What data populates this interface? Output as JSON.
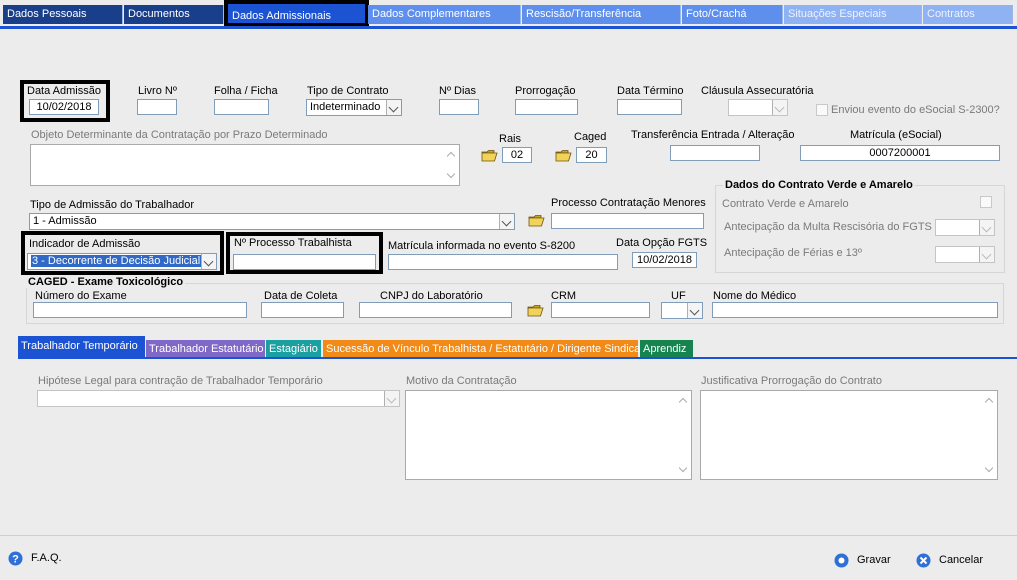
{
  "tabs": {
    "dados_pessoais": "Dados Pessoais",
    "documentos": "Documentos",
    "dados_admissionais": "Dados Admissionais",
    "dados_complementares": "Dados Complementares",
    "rescisao": "Rescisão/Transferência",
    "foto": "Foto/Crachá",
    "situacoes": "Situações Especiais",
    "contratos": "Contratos"
  },
  "form": {
    "data_admissao_label": "Data Admissão",
    "data_admissao_value": "10/02/2018",
    "livro_label": "Livro Nº",
    "folha_label": "Folha / Ficha",
    "tipo_contrato_label": "Tipo de Contrato",
    "tipo_contrato_value": "Indeterminado",
    "dias_label": "Nº Dias",
    "prorrogacao_label": "Prorrogação",
    "data_termino_label": "Data Término",
    "clausula_label": "Cláusula Assecuratória",
    "esocial_label": "Enviou evento do eSocial S-2300?",
    "objeto_label": "Objeto Determinante da Contratação por Prazo Determinado",
    "rais_label": "Rais",
    "rais_value": "02",
    "caged_label": "Caged",
    "caged_value": "20",
    "transferencia_label": "Transferência Entrada / Alteração",
    "matricula_label": "Matrícula (eSocial)",
    "matricula_value": "0007200001",
    "tipo_admissao_label": "Tipo de Admissão do Trabalhador",
    "tipo_admissao_value": "1 - Admissão",
    "processo_menores_label": "Processo Contratação Menores",
    "indicador_label": "Indicador de Admissão",
    "indicador_value": "3 - Decorrente de Decisão Judicial",
    "processo_trab_label": "Nº Processo Trabalhista",
    "matricula_s8200_label": "Matrícula informada no evento S-8200",
    "data_fgts_label": "Data Opção FGTS",
    "data_fgts_value": "10/02/2018"
  },
  "verde_amarelo": {
    "title": "Dados do Contrato Verde e Amarelo",
    "contrato_label": "Contrato Verde e Amarelo",
    "multa_label": "Antecipação da Multa Rescisória do FGTS",
    "ferias_label": "Antecipação de Férias e 13º"
  },
  "caged": {
    "title": "CAGED - Exame Toxicológico",
    "numero_label": "Número do Exame",
    "coleta_label": "Data de Coleta",
    "cnpj_label": "CNPJ do Laboratório",
    "crm_label": "CRM",
    "uf_label": "UF",
    "medico_label": "Nome do Médico"
  },
  "sub_tabs": {
    "temporario": "Trabalhador Temporário",
    "estatutario": "Trabalhador Estatutário",
    "estagiario": "Estagiário",
    "sucessao": "Sucessão de Vínculo Trabalhista / Estatutário / Dirigente Sindical",
    "aprendiz": "Aprendiz"
  },
  "temporario": {
    "hipotese_label": "Hipótese Legal para contração de Trabalhador Temporário",
    "motivo_label": "Motivo da Contratação",
    "justificativa_label": "Justificativa Prorrogação do Contrato"
  },
  "footer": {
    "faq": "F.A.Q.",
    "gravar": "Gravar",
    "cancelar": "Cancelar"
  },
  "colors": {
    "tab_dark": "#1a3f8a",
    "tab_light": "#5f8fec",
    "tab_active": "#1b53d3",
    "estatutario": "#8068c8",
    "estagiario": "#1aa0a0",
    "sucessao": "#f28a17",
    "aprendiz": "#15844e"
  }
}
